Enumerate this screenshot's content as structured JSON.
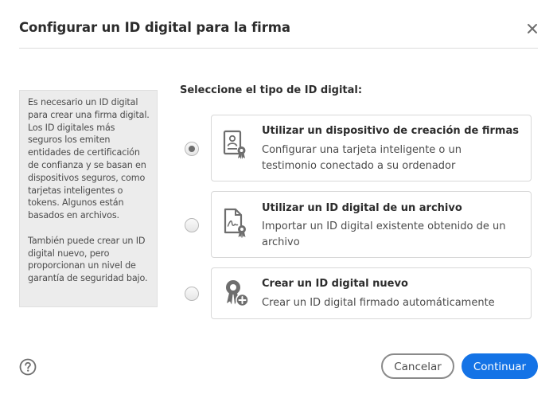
{
  "dialog": {
    "title": "Configurar un ID digital para la firma",
    "close_icon": "close-icon"
  },
  "info_panel": {
    "paragraph1": "Es necesario un ID digital para crear una firma digital. Los ID digitales más seguros los emiten entidades de certificación de confianza y se basan en dispositivos seguros, como tarjetas inteligentes o tokens. Algunos están basados en archivos.",
    "paragraph2": "También puede crear un ID digital nuevo, pero proporcionan un nivel de garantía de seguridad bajo."
  },
  "selection": {
    "label": "Seleccione el tipo de ID digital:",
    "selected_index": 0,
    "options": [
      {
        "title": "Utilizar un dispositivo de creación de firmas",
        "description": "Configurar una tarjeta inteligente o un testimonio conectado a su ordenador",
        "icon": "signature-device-icon",
        "selected": true
      },
      {
        "title": "Utilizar un ID digital de un archivo",
        "description": "Importar un ID digital existente obtenido de un archivo",
        "icon": "digital-id-file-icon",
        "selected": false
      },
      {
        "title": "Crear un ID digital nuevo",
        "description": "Crear un ID digital firmado automáticamente",
        "icon": "new-digital-id-icon",
        "selected": false
      }
    ]
  },
  "footer": {
    "help_icon": "help-icon",
    "cancel_label": "Cancelar",
    "continue_label": "Continuar"
  },
  "colors": {
    "primary_button": "#1473e6",
    "info_panel_bg": "#ececec",
    "icon_gray": "#6e6e6e"
  }
}
